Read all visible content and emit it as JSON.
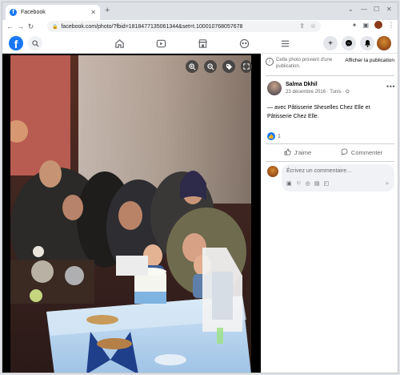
{
  "browser": {
    "tab_title": "Facebook",
    "url": "facebook.com/photo/?fbid=1818477135061344&set=t.100010768057678"
  },
  "notice": {
    "text": "Cette photo provient d'une publication.",
    "show_post": "Afficher la publication"
  },
  "post": {
    "author": "Salma Dkhil",
    "date": "23 décembre 2016 · Tunis ·",
    "caption_prefix": "— avec ",
    "tag1": "Pâtisserie Sheselles Chez Elle",
    "caption_mid": " et ",
    "tag2": "Pâtisserie Chez Elle",
    "caption_suffix": ".",
    "like_count": "1"
  },
  "actions": {
    "like": "J'aime",
    "comment": "Commenter"
  },
  "composer": {
    "placeholder": "Écrivez un commentaire…"
  },
  "colors": {
    "facebook_blue": "#1877f2"
  }
}
